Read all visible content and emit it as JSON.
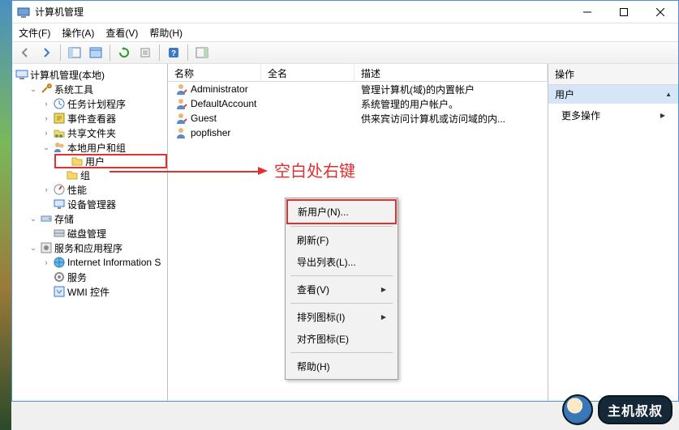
{
  "window": {
    "title": "计算机管理"
  },
  "menu": {
    "file": "文件(F)",
    "action": "操作(A)",
    "view": "查看(V)",
    "help": "帮助(H)"
  },
  "tree": {
    "root": "计算机管理(本地)",
    "systools": "系统工具",
    "task": "任务计划程序",
    "event": "事件查看器",
    "shared": "共享文件夹",
    "localusers": "本地用户和组",
    "users": "用户",
    "groups": "组",
    "perf": "性能",
    "devmgr": "设备管理器",
    "storage": "存储",
    "diskmgmt": "磁盘管理",
    "services_apps": "服务和应用程序",
    "iis": "Internet Information S",
    "services": "服务",
    "wmi": "WMI 控件"
  },
  "list": {
    "headers": {
      "name": "名称",
      "fullname": "全名",
      "desc": "描述"
    },
    "rows": [
      {
        "name": "Administrator",
        "full": "",
        "desc": "管理计算机(域)的内置帐户"
      },
      {
        "name": "DefaultAccount",
        "full": "",
        "desc": "系统管理的用户帐户。"
      },
      {
        "name": "Guest",
        "full": "",
        "desc": "供来宾访问计算机或访问域的内..."
      },
      {
        "name": "popfisher",
        "full": "",
        "desc": ""
      }
    ]
  },
  "actions": {
    "header": "操作",
    "scope": "用户",
    "more": "更多操作"
  },
  "context": {
    "newuser": "新用户(N)...",
    "refresh": "刷新(F)",
    "export": "导出列表(L)...",
    "view": "查看(V)",
    "arrange": "排列图标(I)",
    "align": "对齐图标(E)",
    "help": "帮助(H)"
  },
  "annotation": "空白处右键",
  "watermark": "主机叔叔"
}
